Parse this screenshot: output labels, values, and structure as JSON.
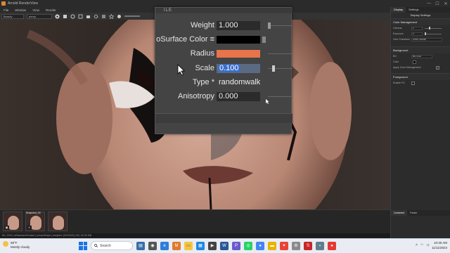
{
  "window": {
    "title": "Arnold RenderView",
    "min": "—",
    "max": "☐",
    "close": "✕"
  },
  "menu": [
    "File",
    "Window",
    "View",
    "Render"
  ],
  "toolbar": {
    "camera_select": "Beauty",
    "shader_select": "persp",
    "zoom": "1:1"
  },
  "popup": {
    "header": "ILE",
    "rows": [
      {
        "label": "Weight",
        "value": "1.000",
        "kind": "field"
      },
      {
        "label": "oSurface Color",
        "suffix": "≡",
        "kind": "swatch",
        "color": "#000000"
      },
      {
        "label": "Radius",
        "kind": "swatch",
        "color": "#e8744a"
      },
      {
        "label": "Scale",
        "value": "0.100",
        "kind": "field-hl"
      },
      {
        "label": "Type *",
        "value": "randomwalk",
        "kind": "text"
      },
      {
        "label": "Anisotropy",
        "value": "0.000",
        "kind": "field"
      }
    ]
  },
  "right_panel": {
    "tabs": [
      "Display",
      "Settings"
    ],
    "title": "Display Settings",
    "color_mgmt": {
      "heading": "Color Management",
      "gamma_label": "Gamma",
      "gamma_value": "1",
      "exposure_label": "Exposure",
      "exposure_value": "0",
      "view_transform_label": "View Transform",
      "view_transform_value": "ACES (sRGB)"
    },
    "background": {
      "heading": "Background",
      "bg_label": "BG",
      "bg_value": "BG Color",
      "color_label": "Color",
      "apply_label": "Apply Color Management"
    },
    "foreground": {
      "heading": "Foreground",
      "enable_label": "Enable FG"
    },
    "bottom_tabs": [
      "Comment",
      "Folder"
    ]
  },
  "thumbnails": [
    {
      "label": "",
      "icon": "▣"
    },
    {
      "label": "Snapshot_03",
      "icon": "⏸"
    },
    {
      "label": "",
      "icon": ""
    }
  ],
  "status": "80 | 2024 | aiStandardSurface | persp/Shape | samples: [3/2/3/3/2] | 96 | 33.00 MB",
  "taskbar": {
    "temp": "68°F",
    "weather": "Mostly cloudy",
    "search_placeholder": "Search",
    "time": "10:30 AM",
    "date": "11/11/2024"
  },
  "colors": {
    "accent": "#3c6fc7",
    "radius_swatch": "#e8744a"
  }
}
